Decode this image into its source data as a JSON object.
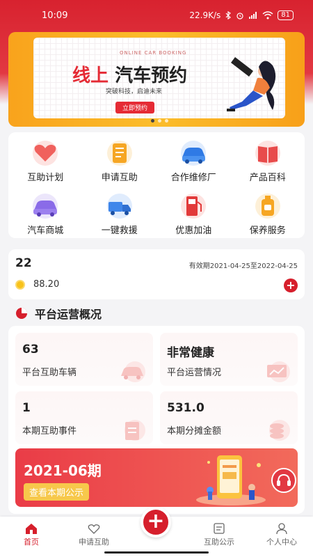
{
  "status": {
    "time": "10:09",
    "speed": "22.9K/s",
    "battery": "81"
  },
  "banner": {
    "subtitle": "ONLINE CAR BOOKING",
    "title_highlight": "线上",
    "title_rest": "汽车预约",
    "slogan": "突破科技，启迪未来",
    "button": "立即预约"
  },
  "grid": {
    "items": [
      {
        "label": "互助计划",
        "icon": "heart-hands-icon"
      },
      {
        "label": "申请互助",
        "icon": "form-icon"
      },
      {
        "label": "合作维修厂",
        "icon": "repair-car-icon"
      },
      {
        "label": "产品百科",
        "icon": "book-icon"
      },
      {
        "label": "汽车商城",
        "icon": "car-icon"
      },
      {
        "label": "一键救援",
        "icon": "tow-truck-icon"
      },
      {
        "label": "优惠加油",
        "icon": "fuel-pump-icon"
      },
      {
        "label": "保养服务",
        "icon": "oil-can-icon"
      }
    ]
  },
  "member": {
    "id": "22",
    "valid": "有效期2021-04-25至2022-04-25",
    "balance": "88.20",
    "add": "+"
  },
  "overview": {
    "title": "平台运营概况",
    "stats": [
      {
        "value": "63",
        "label": "平台互助车辆"
      },
      {
        "value": "非常健康",
        "label": "平台运营情况"
      },
      {
        "value": "1",
        "label": "本期互助事件"
      },
      {
        "value": "531.0",
        "label": "本期分摊金额"
      }
    ],
    "period": "2021-06期",
    "period_button": "查看本期公示"
  },
  "nav": {
    "items": [
      {
        "label": "首页",
        "icon": "home-icon",
        "active": true
      },
      {
        "label": "申请互助",
        "icon": "handshake-icon",
        "active": false
      },
      {
        "label": "互助公示",
        "icon": "document-icon",
        "active": false
      },
      {
        "label": "个人中心",
        "icon": "user-icon",
        "active": false
      }
    ],
    "fab": "+"
  },
  "colors": {
    "primary": "#d61f2c",
    "banner": "#fbbd2b",
    "accent_yellow": "#f7c84b"
  }
}
